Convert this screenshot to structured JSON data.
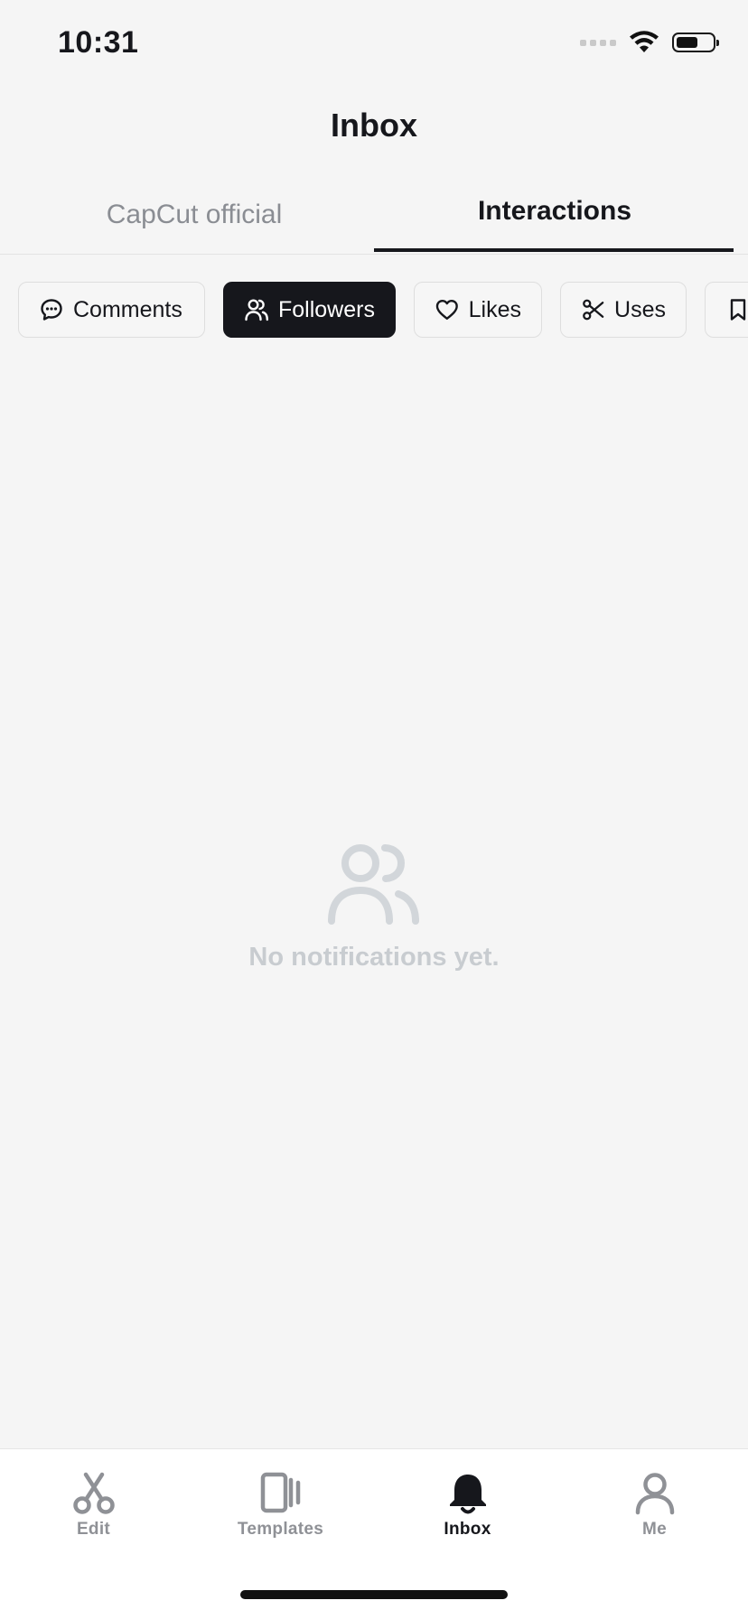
{
  "status_bar": {
    "time": "10:31"
  },
  "header": {
    "title": "Inbox"
  },
  "top_tabs": [
    {
      "label": "CapCut official",
      "active": false
    },
    {
      "label": "Interactions",
      "active": true
    }
  ],
  "filter_chips": [
    {
      "label": "Comments",
      "icon": "comment-icon",
      "active": false
    },
    {
      "label": "Followers",
      "icon": "followers-icon",
      "active": true
    },
    {
      "label": "Likes",
      "icon": "heart-icon",
      "active": false
    },
    {
      "label": "Uses",
      "icon": "scissors-icon",
      "active": false
    },
    {
      "label": "",
      "icon": "bookmark-icon",
      "active": false
    }
  ],
  "empty_state": {
    "icon": "followers-icon",
    "message": "No notifications yet."
  },
  "bottom_nav": [
    {
      "label": "Edit",
      "icon": "scissors-icon",
      "active": false
    },
    {
      "label": "Templates",
      "icon": "templates-icon",
      "active": false
    },
    {
      "label": "Inbox",
      "icon": "bell-icon",
      "active": true
    },
    {
      "label": "Me",
      "icon": "person-icon",
      "active": false
    }
  ],
  "colors": {
    "active": "#16171c",
    "inactive": "#8f9196",
    "empty_state": "#c8ccd0",
    "background": "#f5f5f5"
  }
}
